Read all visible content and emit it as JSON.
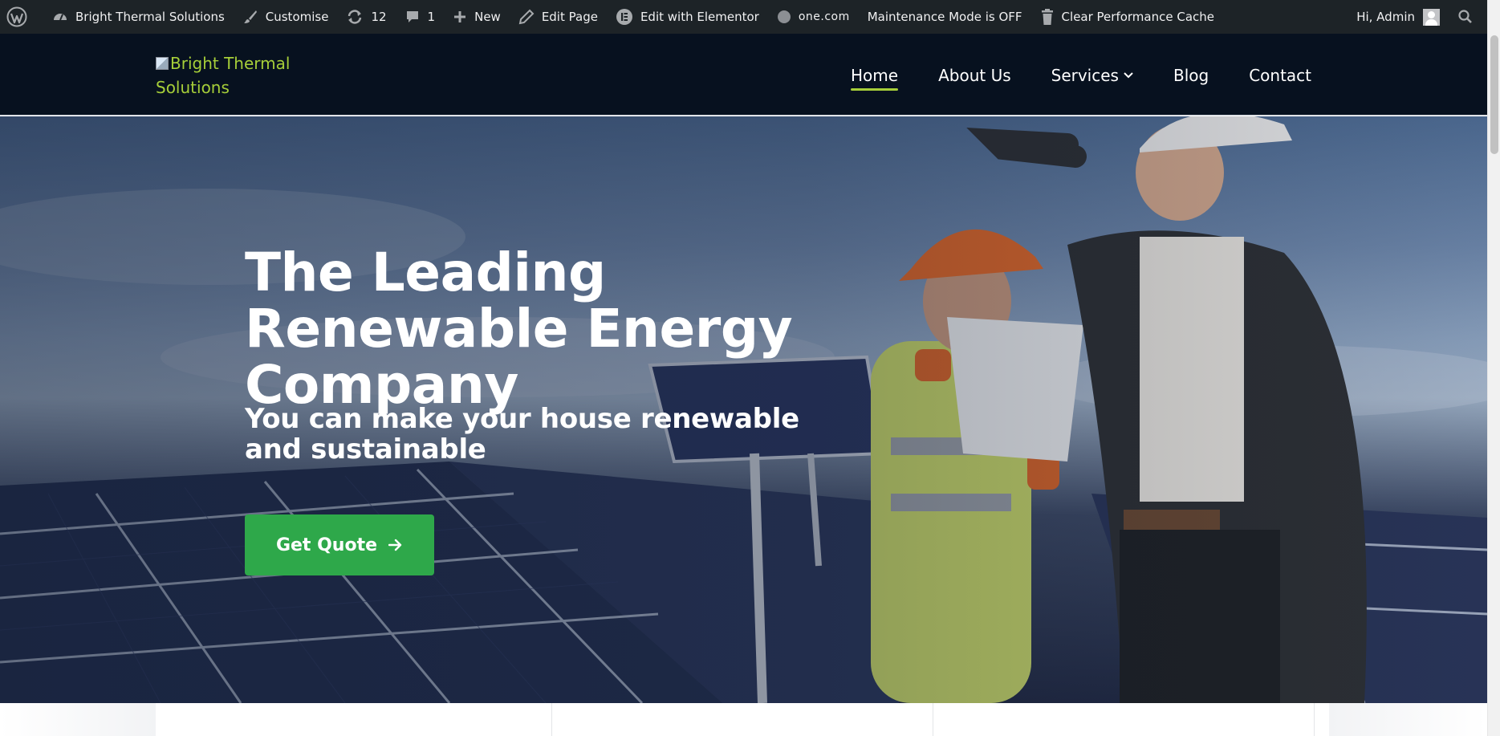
{
  "admin_bar": {
    "wp_logo_icon": "wordpress-logo-icon",
    "site_name": "Bright Thermal Solutions",
    "customise": "Customise",
    "updates_count": "12",
    "comments_count": "1",
    "new": "New",
    "edit_page": "Edit Page",
    "elementor": "Edit with Elementor",
    "onecom": "one.com",
    "maintenance": "Maintenance Mode is OFF",
    "clear_cache": "Clear Performance Cache",
    "greeting": "Hi, Admin"
  },
  "header": {
    "logo_alt": "Bright Thermal Solutions",
    "nav": [
      {
        "label": "Home",
        "active": true
      },
      {
        "label": "About Us"
      },
      {
        "label": "Services",
        "dropdown": true
      },
      {
        "label": "Blog"
      },
      {
        "label": "Contact"
      }
    ]
  },
  "hero": {
    "title": "The Leading Renewable Energy Company",
    "subtitle": "You can make your house renewable and sustainable",
    "cta": "Get Quote"
  },
  "colors": {
    "admin_bar": "#1d2327",
    "header_bg": "#07111f",
    "accent_green": "#a6ce39",
    "button_green": "#2ea84a"
  }
}
